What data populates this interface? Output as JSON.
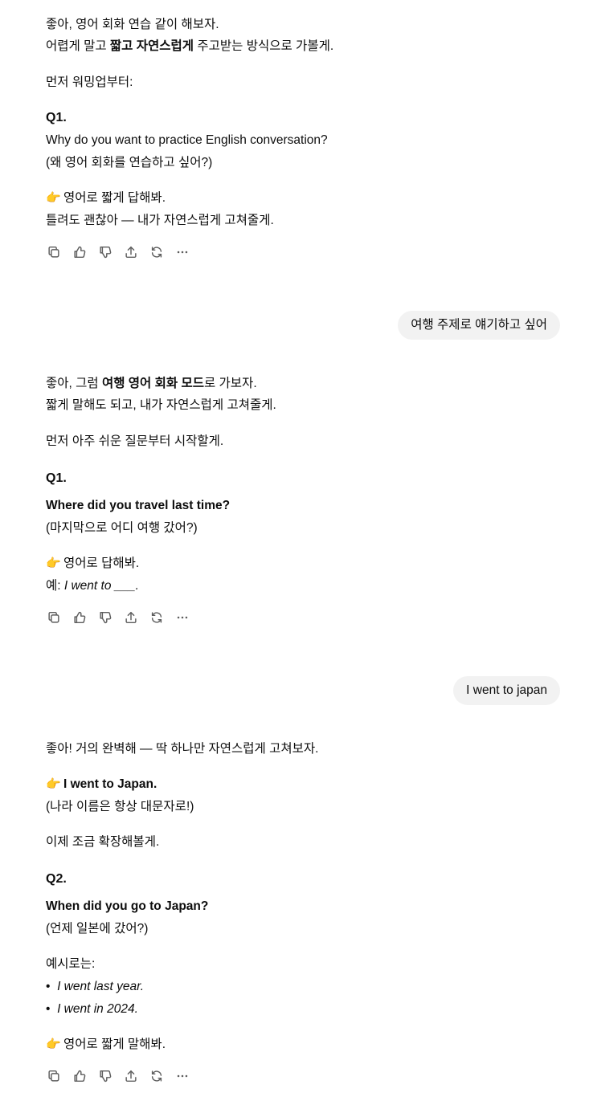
{
  "messages": {
    "m1": {
      "line1": "좋아, 영어 회화 연습 같이 해보자.",
      "line2_pre": "어렵게 말고 ",
      "line2_bold": "짧고 자연스럽게",
      "line2_post": " 주고받는 방식으로 가볼게.",
      "line3": "먼저 워밍업부터:",
      "q_label": "Q1.",
      "q_text": "Why do you want to practice English conversation?",
      "q_ko": "(왜 영어 회화를 연습하고 싶어?)",
      "emoji": "👉",
      "hint1": "영어로 짧게 답해봐.",
      "hint2": "틀려도 괜찮아 — 내가 자연스럽게 고쳐줄게."
    },
    "u1": {
      "text": "여행 주제로 얘기하고 싶어"
    },
    "m2": {
      "line1_pre": "좋아, 그럼 ",
      "line1_bold": "여행 영어 회화 모드",
      "line1_post": "로 가보자.",
      "line2": "짧게 말해도 되고, 내가 자연스럽게 고쳐줄게.",
      "line3": "먼저 아주 쉬운 질문부터 시작할게.",
      "q_label": "Q1.",
      "q_text": "Where did you travel last time?",
      "q_ko": "(마지막으로 어디 여행 갔어?)",
      "emoji": "👉",
      "hint1": "영어로 답해봐.",
      "hint2_pre": "예: ",
      "hint2_italic": "I went to ___."
    },
    "u2": {
      "text": "I went to japan"
    },
    "m3": {
      "line1": "좋아! 거의 완벽해 — 딱 하나만 자연스럽게 고쳐보자.",
      "emoji": "👉",
      "correction": "I went to Japan.",
      "correction_note": "(나라 이름은 항상 대문자로!)",
      "line3": "이제 조금 확장해볼게.",
      "q_label": "Q2.",
      "q_text": "When did you go to Japan?",
      "q_ko": "(언제 일본에 갔어?)",
      "examples_label": "예시로는:",
      "bullet": "•",
      "examples": [
        "I went last year.",
        "I went in 2024."
      ],
      "hint": "영어로 짧게 말해봐."
    }
  },
  "actions": {
    "copy": "copy-icon",
    "like": "thumbs-up-icon",
    "dislike": "thumbs-down-icon",
    "share": "share-icon",
    "regenerate": "regenerate-icon",
    "more": "more-icon"
  }
}
